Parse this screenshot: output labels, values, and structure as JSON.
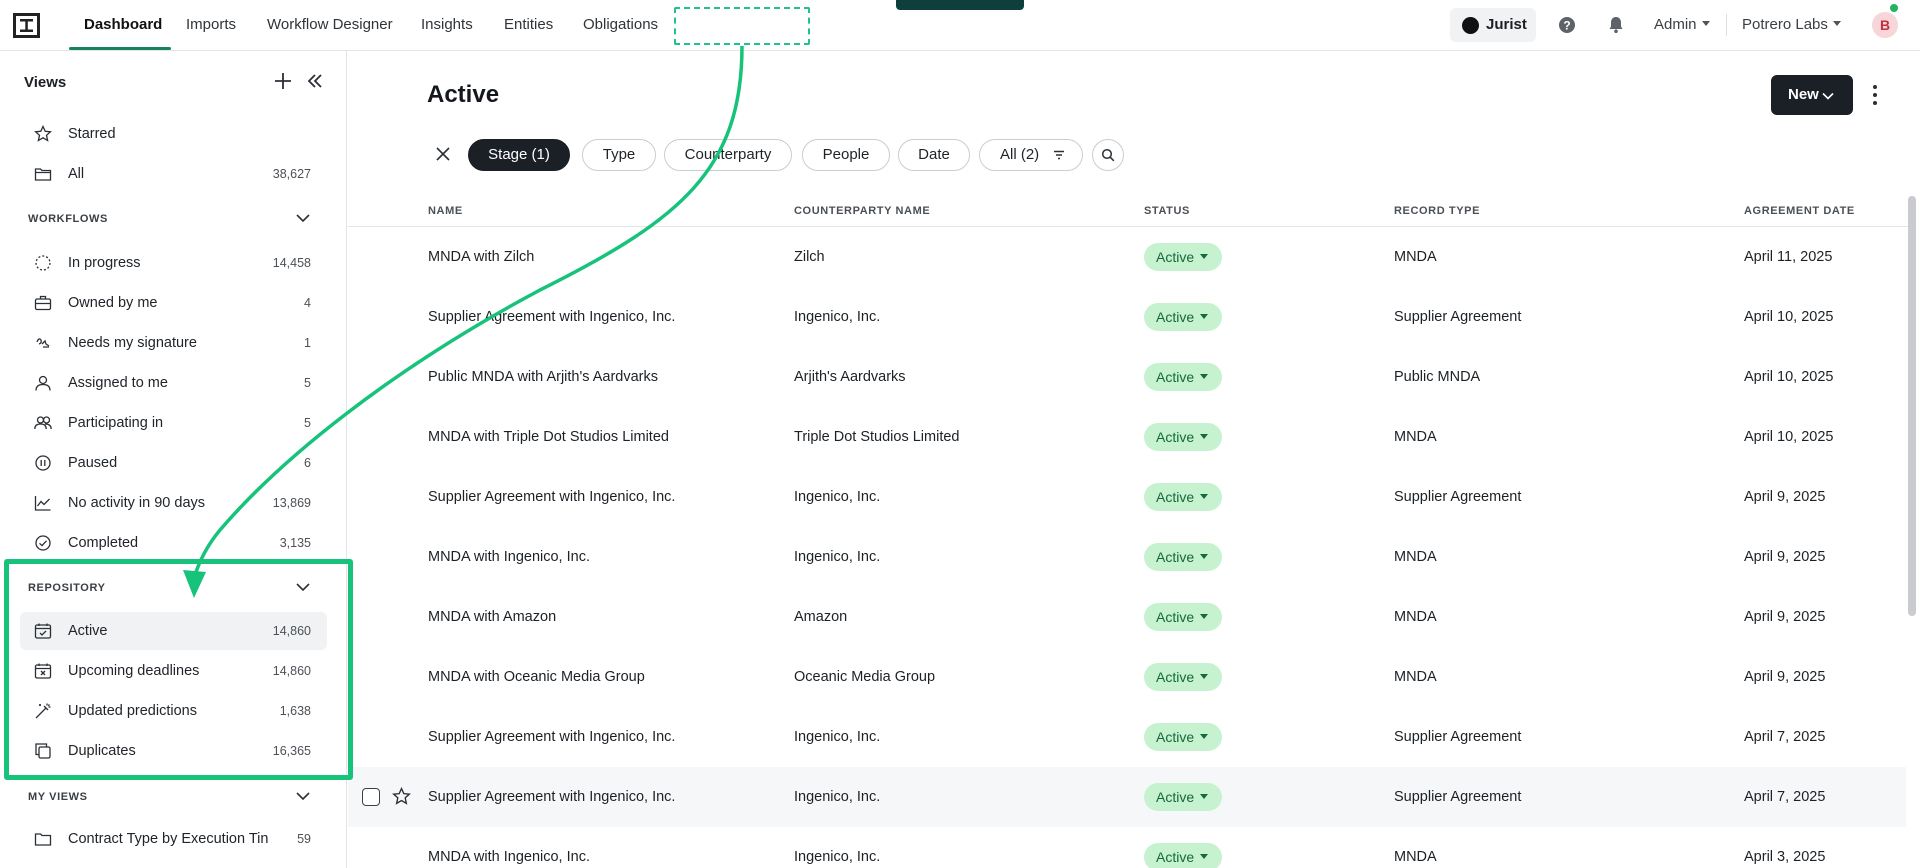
{
  "nav": {
    "tabs": [
      {
        "label": "Dashboard",
        "active": true
      },
      {
        "label": "Imports"
      },
      {
        "label": "Workflow Designer"
      },
      {
        "label": "Insights"
      },
      {
        "label": "Entities"
      },
      {
        "label": "Obligations"
      }
    ],
    "jurist_label": "Jurist",
    "admin_label": "Admin",
    "org_label": "Potrero Labs",
    "avatar_initial": "B"
  },
  "sidebar": {
    "title": "Views",
    "top_items": [
      {
        "label": "Starred",
        "count": "",
        "icon": "star-icon"
      },
      {
        "label": "All",
        "count": "38,627",
        "icon": "folder-icon"
      }
    ],
    "workflows": {
      "title": "WORKFLOWS",
      "items": [
        {
          "label": "In progress",
          "count": "14,458",
          "icon": "dotted-circle-icon"
        },
        {
          "label": "Owned by me",
          "count": "4",
          "icon": "briefcase-icon"
        },
        {
          "label": "Needs my signature",
          "count": "1",
          "icon": "signature-icon"
        },
        {
          "label": "Assigned to me",
          "count": "5",
          "icon": "user-icon"
        },
        {
          "label": "Participating in",
          "count": "5",
          "icon": "users-icon"
        },
        {
          "label": "Paused",
          "count": "6",
          "icon": "pause-icon"
        },
        {
          "label": "No activity in 90 days",
          "count": "13,869",
          "icon": "chart-line-icon"
        },
        {
          "label": "Completed",
          "count": "3,135",
          "icon": "check-circle-icon"
        }
      ]
    },
    "repository": {
      "title": "REPOSITORY",
      "items": [
        {
          "label": "Active",
          "count": "14,860",
          "icon": "calendar-check-icon",
          "selected": true
        },
        {
          "label": "Upcoming deadlines",
          "count": "14,860",
          "icon": "calendar-x-icon"
        },
        {
          "label": "Updated predictions",
          "count": "1,638",
          "icon": "magic-wand-icon"
        },
        {
          "label": "Duplicates",
          "count": "16,365",
          "icon": "copy-icon"
        }
      ]
    },
    "my_views": {
      "title": "MY VIEWS",
      "items": [
        {
          "label": "Contract Type by Execution Tin",
          "count": "59",
          "icon": "folder-icon"
        }
      ]
    }
  },
  "main": {
    "title": "Active",
    "new_button": "New",
    "filters": {
      "chips": [
        "Stage (1)",
        "Type",
        "Counterparty",
        "People",
        "Date",
        "All (2)"
      ]
    },
    "table": {
      "columns": [
        "NAME",
        "COUNTERPARTY NAME",
        "STATUS",
        "RECORD TYPE",
        "AGREEMENT DATE"
      ],
      "rows": [
        {
          "name": "MNDA with Zilch",
          "counterparty": "Zilch",
          "status": "Active",
          "record_type": "MNDA",
          "date": "April 11, 2025"
        },
        {
          "name": "Supplier Agreement with Ingenico, Inc.",
          "counterparty": "Ingenico, Inc.",
          "status": "Active",
          "record_type": "Supplier Agreement",
          "date": "April 10, 2025"
        },
        {
          "name": "Public MNDA with Arjith's Aardvarks",
          "counterparty": "Arjith's Aardvarks",
          "status": "Active",
          "record_type": "Public MNDA",
          "date": "April 10, 2025"
        },
        {
          "name": "MNDA with Triple Dot Studios Limited",
          "counterparty": "Triple Dot Studios Limited",
          "status": "Active",
          "record_type": "MNDA",
          "date": "April 10, 2025"
        },
        {
          "name": "Supplier Agreement with Ingenico, Inc.",
          "counterparty": "Ingenico, Inc.",
          "status": "Active",
          "record_type": "Supplier Agreement",
          "date": "April 9, 2025"
        },
        {
          "name": "MNDA with Ingenico, Inc.",
          "counterparty": "Ingenico, Inc.",
          "status": "Active",
          "record_type": "MNDA",
          "date": "April 9, 2025"
        },
        {
          "name": "MNDA with Amazon",
          "counterparty": "Amazon",
          "status": "Active",
          "record_type": "MNDA",
          "date": "April 9, 2025"
        },
        {
          "name": "MNDA with Oceanic Media Group",
          "counterparty": "Oceanic Media Group",
          "status": "Active",
          "record_type": "MNDA",
          "date": "April 9, 2025"
        },
        {
          "name": "Supplier Agreement with Ingenico, Inc.",
          "counterparty": "Ingenico, Inc.",
          "status": "Active",
          "record_type": "Supplier Agreement",
          "date": "April 7, 2025"
        },
        {
          "name": "Supplier Agreement with Ingenico, Inc.",
          "counterparty": "Ingenico, Inc.",
          "status": "Active",
          "record_type": "Supplier Agreement",
          "date": "April 7, 2025",
          "hovered": true
        },
        {
          "name": "MNDA with Ingenico, Inc.",
          "counterparty": "Ingenico, Inc.",
          "status": "Active",
          "record_type": "MNDA",
          "date": "April 3, 2025"
        }
      ]
    }
  },
  "colors": {
    "accent": "#17825e",
    "highlight": "#17c27b",
    "status_bg": "#c6f2d0",
    "status_text": "#15683a",
    "dark": "#1b1f26"
  }
}
